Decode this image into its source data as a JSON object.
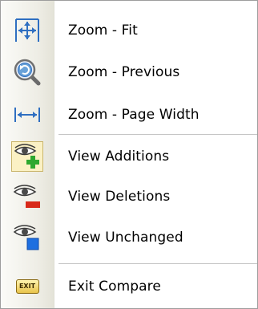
{
  "menu": {
    "items": [
      {
        "label": "Zoom - Fit",
        "icon": "zoom-fit-icon"
      },
      {
        "label": "Zoom - Previous",
        "icon": "zoom-previous-icon"
      },
      {
        "label": "Zoom - Page Width",
        "icon": "zoom-page-width-icon"
      },
      {
        "label": "View Additions",
        "icon": "view-additions-icon"
      },
      {
        "label": "View Deletions",
        "icon": "view-deletions-icon"
      },
      {
        "label": "View Unchanged",
        "icon": "view-unchanged-icon"
      },
      {
        "label": "Exit Compare",
        "icon": "exit-icon",
        "badge": "EXIT"
      }
    ]
  },
  "colors": {
    "accent_blue": "#2f6fc1",
    "add_green": "#2fa82f",
    "delete_red": "#d82a1a",
    "unchanged_blue": "#1e6fe0"
  }
}
